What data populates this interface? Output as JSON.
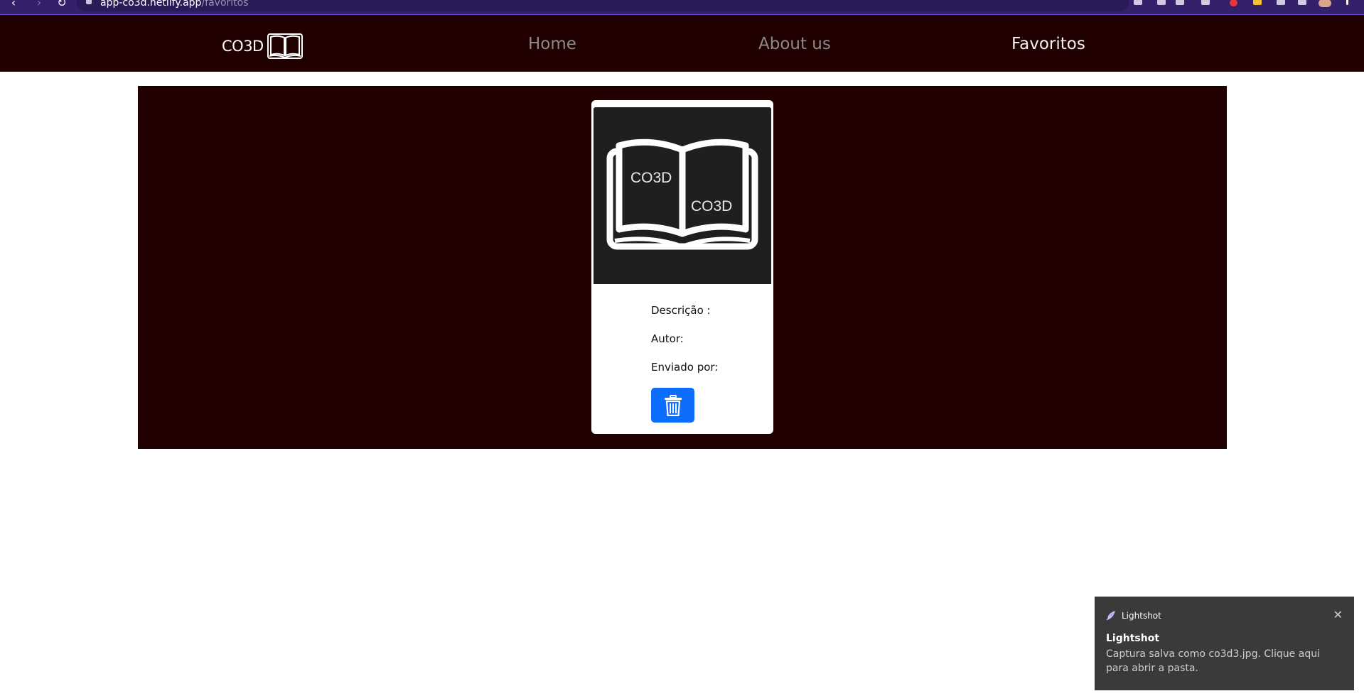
{
  "browser": {
    "url_host": "app-co3d.netlify.app",
    "url_path": "/favoritos"
  },
  "navbar": {
    "brand": "CO3D",
    "links": [
      {
        "label": "Home",
        "active": false
      },
      {
        "label": "About us",
        "active": false
      },
      {
        "label": "Favoritos",
        "active": true
      }
    ]
  },
  "card": {
    "image_text_left": "CO3D",
    "image_text_right": "CO3D",
    "descricao_label": "Descrição :",
    "autor_label": "Autor:",
    "enviado_label": "Enviado por:",
    "delete_icon": "trash-icon"
  },
  "toast": {
    "app_name": "Lightshot",
    "title": "Lightshot",
    "message": "Captura salva como co3d3.jpg. Clique aqui para abrir a pasta.",
    "close_glyph": "✕"
  },
  "colors": {
    "navbar_bg": "#210000",
    "card_image_bg": "#1f1f1f",
    "button_primary": "#0d6efd",
    "browser_chrome": "#35206b",
    "toast_bg": "#3a3a3a"
  }
}
